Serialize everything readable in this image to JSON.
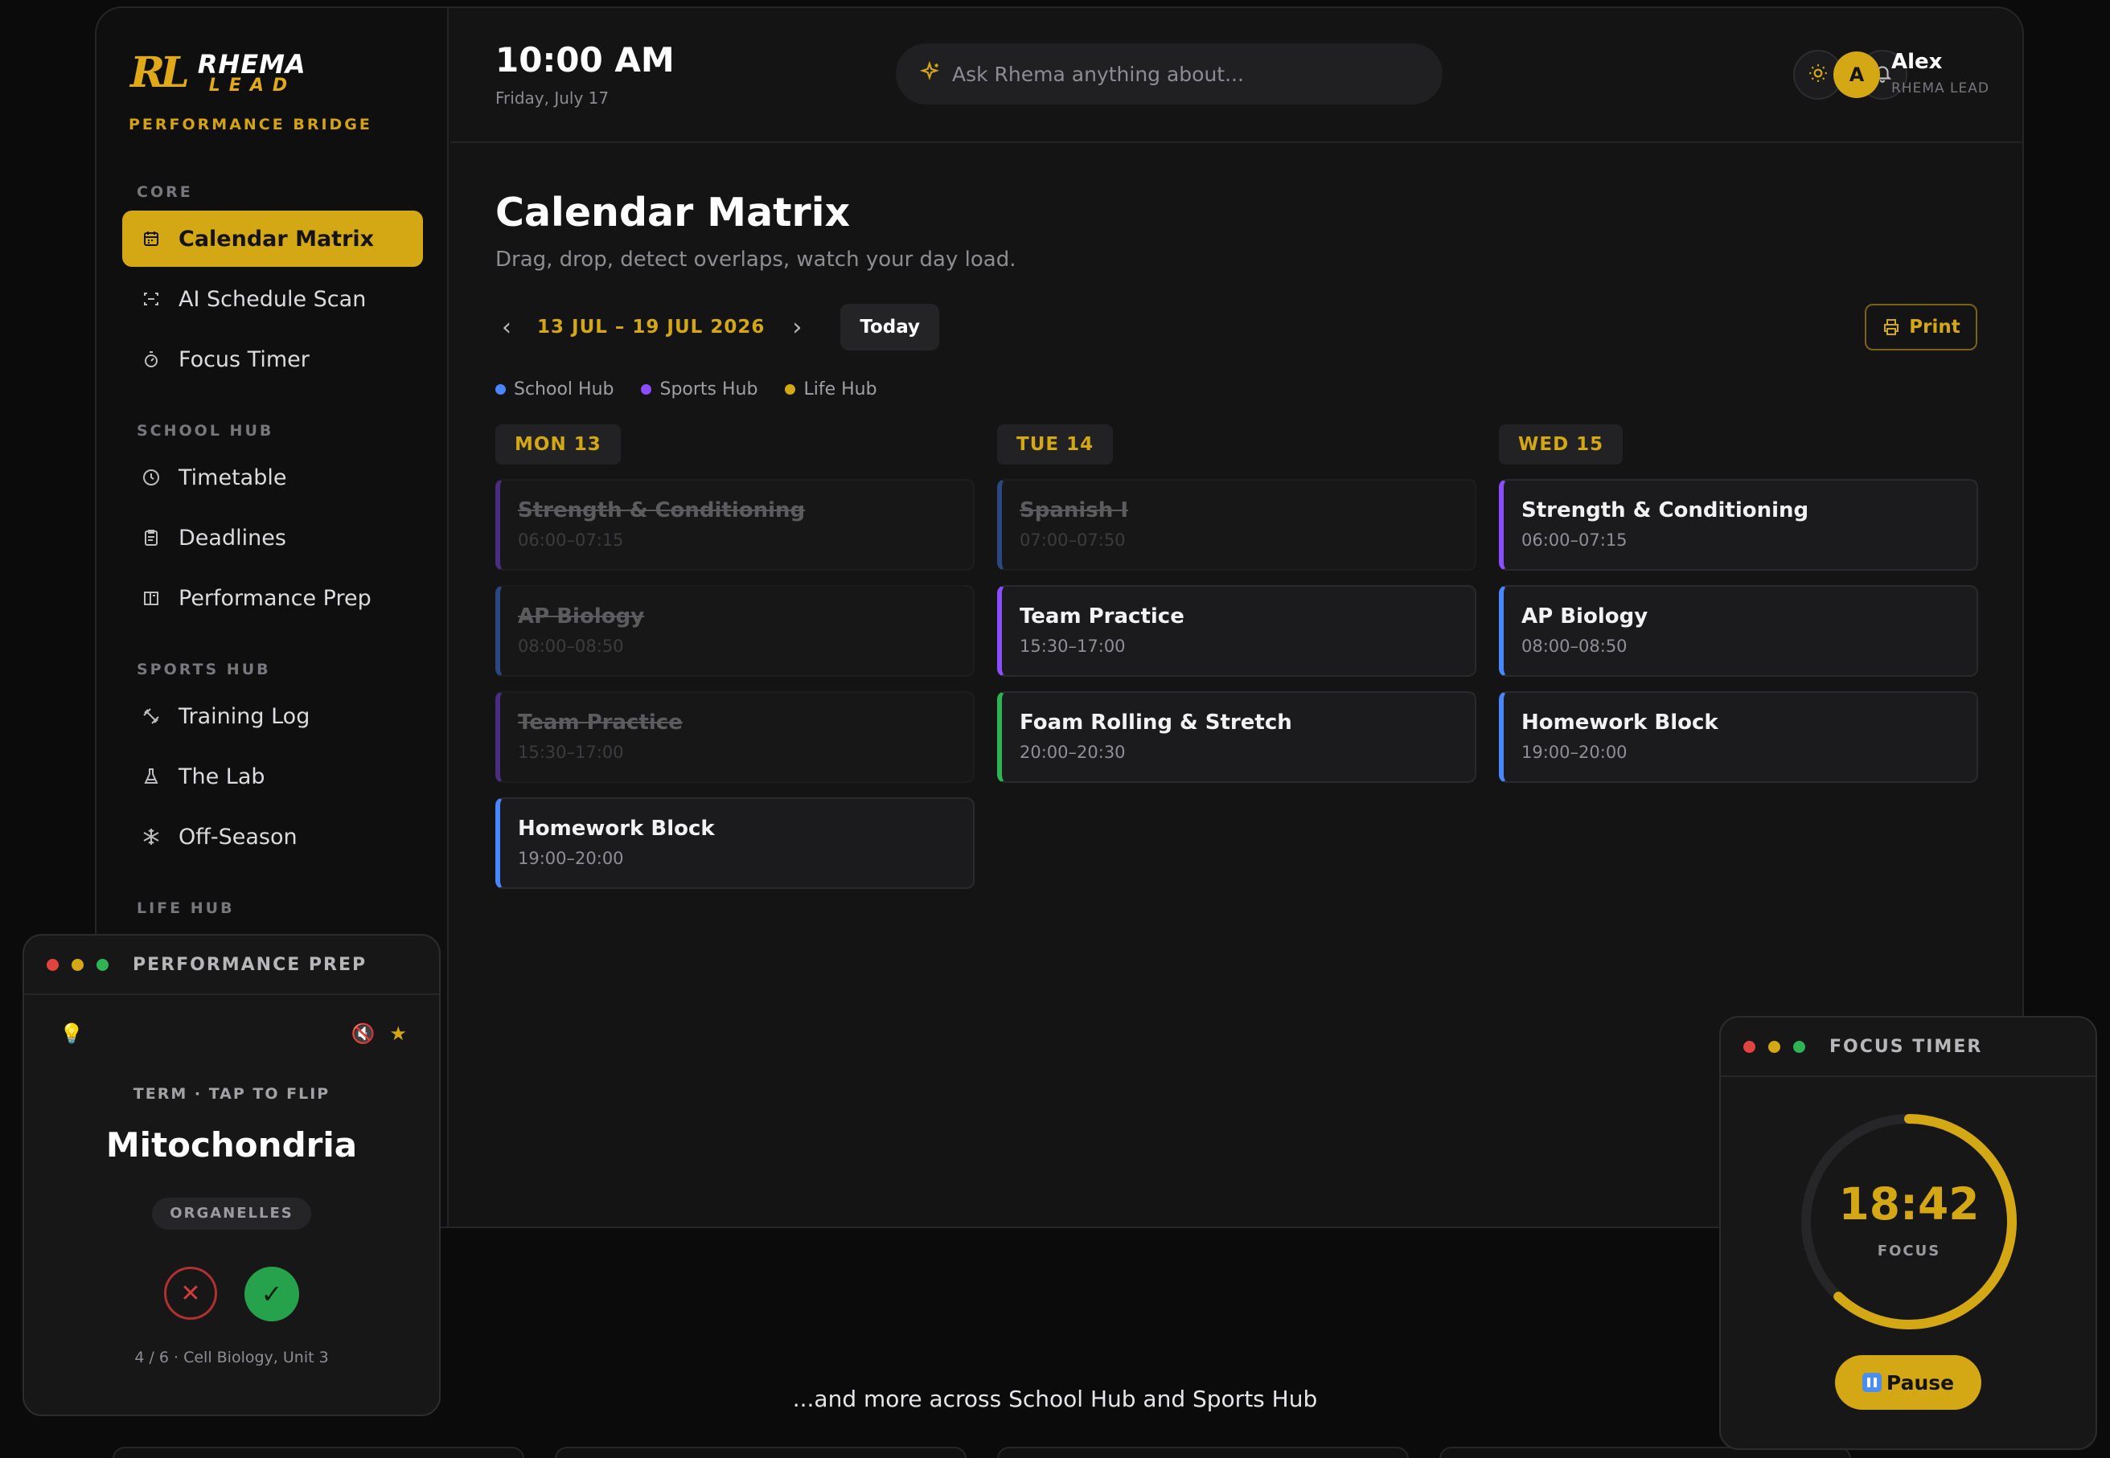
{
  "brand": {
    "logo_mark": "RL",
    "logo_word1": "RHEMA",
    "logo_word2": "LEAD",
    "subtitle": "PERFORMANCE BRIDGE"
  },
  "sidebar": {
    "sections": [
      {
        "label": "CORE",
        "items": [
          {
            "label": "Calendar Matrix",
            "icon": "calendar-icon",
            "active": true
          },
          {
            "label": "AI Schedule Scan",
            "icon": "scan-icon"
          },
          {
            "label": "Focus Timer",
            "icon": "stopwatch-icon"
          }
        ]
      },
      {
        "label": "SCHOOL HUB",
        "items": [
          {
            "label": "Timetable",
            "icon": "clock-icon"
          },
          {
            "label": "Deadlines",
            "icon": "clipboard-icon"
          },
          {
            "label": "Performance Prep",
            "icon": "book-icon"
          }
        ]
      },
      {
        "label": "SPORTS HUB",
        "items": [
          {
            "label": "Training Log",
            "icon": "dumbbell-icon"
          },
          {
            "label": "The Lab",
            "icon": "flask-icon"
          },
          {
            "label": "Off-Season",
            "icon": "snowflake-icon"
          }
        ]
      },
      {
        "label": "LIFE HUB",
        "items": []
      }
    ]
  },
  "topbar": {
    "time": "10:00 AM",
    "date": "Friday, July 17",
    "search_placeholder": "Ask Rhema anything about...",
    "user_initial": "A",
    "user_name": "Alex",
    "user_role": "RHEMA LEAD"
  },
  "page": {
    "title": "Calendar Matrix",
    "subtitle": "Drag, drop, detect overlaps, watch your day load.",
    "range": "13 JUL – 19 JUL 2026",
    "today_label": "Today",
    "print_label": "Print",
    "legend": [
      {
        "label": "School Hub",
        "color": "#4a86ff"
      },
      {
        "label": "Sports Hub",
        "color": "#8a4dff"
      },
      {
        "label": "Life Hub",
        "color": "#d4a715"
      }
    ]
  },
  "days": [
    {
      "label": "MON 13",
      "events": [
        {
          "title": "Strength & Conditioning",
          "time": "06:00–07:15",
          "hub": "sports",
          "done": true
        },
        {
          "title": "AP Biology",
          "time": "08:00–08:50",
          "hub": "school",
          "done": true
        },
        {
          "title": "Team Practice",
          "time": "15:30–17:00",
          "hub": "sports",
          "done": true
        },
        {
          "title": "Homework Block",
          "time": "19:00–20:00",
          "hub": "school",
          "done": false
        }
      ]
    },
    {
      "label": "TUE 14",
      "events": [
        {
          "title": "Spanish I",
          "time": "07:00–07:50",
          "hub": "school",
          "done": true
        },
        {
          "title": "Team Practice",
          "time": "15:30–17:00",
          "hub": "sports",
          "done": false
        },
        {
          "title": "Foam Rolling & Stretch",
          "time": "20:00–20:30",
          "hub": "recovery",
          "done": false
        }
      ]
    },
    {
      "label": "WED 15",
      "events": [
        {
          "title": "Strength & Conditioning",
          "time": "06:00–07:15",
          "hub": "sports",
          "done": false
        },
        {
          "title": "AP Biology",
          "time": "08:00–08:50",
          "hub": "school",
          "done": false
        },
        {
          "title": "Homework Block",
          "time": "19:00–20:00",
          "hub": "school",
          "done": false
        }
      ]
    }
  ],
  "hub_colors": {
    "school": "#4a86ff",
    "sports": "#8a4dff",
    "recovery": "#2fb455",
    "life": "#d4a715"
  },
  "footer_text": "...and more across School Hub and Sports Hub",
  "flashcard": {
    "window_title": "PERFORMANCE PREP",
    "kicker": "TERM · TAP TO FLIP",
    "term": "Mitochondria",
    "tag": "ORGANELLES",
    "progress": "4 / 6 · Cell Biology, Unit 3"
  },
  "focus_timer": {
    "window_title": "FOCUS TIMER",
    "time": "18:42",
    "label": "FOCUS",
    "pause_label": "Pause",
    "progress_fraction": 0.62
  }
}
